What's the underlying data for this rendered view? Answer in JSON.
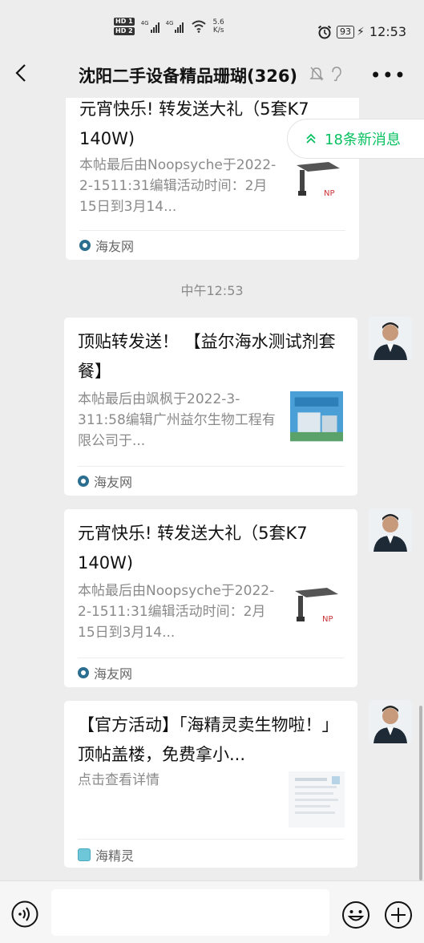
{
  "status_bar": {
    "hd1": "HD 1",
    "hd2": "HD 2",
    "net1": "4G",
    "net2": "4G",
    "speed_value": "5.6",
    "speed_unit": "K/s",
    "battery": "93",
    "time": "12:53"
  },
  "header": {
    "title": "沈阳二手设备精品珊瑚(326)",
    "back_icon": "chevron-left-icon",
    "mute_icon": "bell-off-icon",
    "ear_icon": "ear-icon",
    "more_icon": "more-icon"
  },
  "new_messages": {
    "label": "18条新消息",
    "color": "#07c160"
  },
  "timestamp": "中午12:53",
  "messages": [
    {
      "title": "元宵快乐! 转发送大礼（5套K7 140W)",
      "desc": "本帖最后由Noopsyche于2022-2-1511:31编辑活动时间：2月15日到3月14...",
      "source": "海友网"
    },
    {
      "title": "顶贴转发送！ 【益尔海水测试剂套餐】",
      "desc": "本帖最后由飒枫于2022-3-311:58编辑广州益尔生物工程有限公司于...",
      "source": "海友网"
    },
    {
      "title": "元宵快乐! 转发送大礼（5套K7 140W)",
      "desc": "本帖最后由Noopsyche于2022-2-1511:31编辑活动时间：2月15日到3月14...",
      "source": "海友网"
    },
    {
      "title": "【官方活动】「海精灵卖生物啦！」顶帖盖楼，免费拿小...",
      "desc": "点击查看详情",
      "source": "海精灵"
    }
  ],
  "input": {
    "placeholder": "",
    "voice_icon": "voice-icon",
    "emoji_icon": "emoji-icon",
    "plus_icon": "plus-icon"
  }
}
